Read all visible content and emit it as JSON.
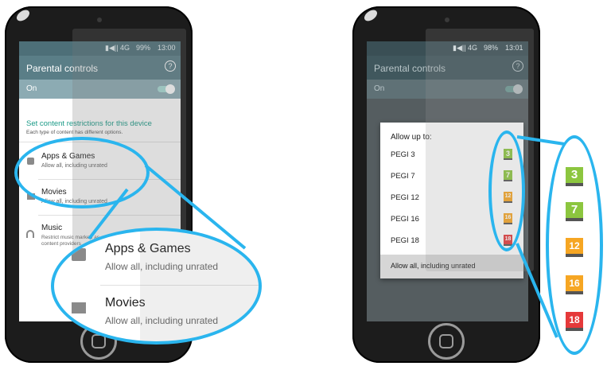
{
  "left_phone": {
    "status": {
      "signal": "▮◀|| 4G",
      "battery": "99%",
      "time": "13:00"
    },
    "appbar_title": "Parental controls",
    "help_glyph": "?",
    "on_label": "On",
    "section_title": "Set content restrictions for this device",
    "section_subtitle": "Each type of content has different options.",
    "items": [
      {
        "title": "Apps & Games",
        "subtitle": "Allow all, including unrated"
      },
      {
        "title": "Movies",
        "subtitle": "Allow all, including unrated"
      },
      {
        "title": "Music",
        "subtitle": "Restrict music marked as explicit by content providers"
      }
    ],
    "music_subtitle_line1": "Restrict music marked as",
    "music_subtitle_line2": "content providers",
    "zoom": [
      {
        "title": "Apps & Games",
        "subtitle": "Allow all, including unrated"
      },
      {
        "title": "Movies",
        "subtitle": "Allow all, including unrated"
      }
    ]
  },
  "right_phone": {
    "status": {
      "signal": "▮◀|| 4G",
      "battery": "98%",
      "time": "13:01"
    },
    "appbar_title": "Parental controls",
    "help_glyph": "?",
    "on_label": "On",
    "dialog_title": "Allow up to:",
    "options": [
      {
        "label": "PEGI 3",
        "badge": "3",
        "color": "#8cc63f"
      },
      {
        "label": "PEGI 7",
        "badge": "7",
        "color": "#8cc63f"
      },
      {
        "label": "PEGI 12",
        "badge": "12",
        "color": "#f6a623"
      },
      {
        "label": "PEGI 16",
        "badge": "16",
        "color": "#f6a623"
      },
      {
        "label": "PEGI 18",
        "badge": "18",
        "color": "#e5393a"
      }
    ],
    "selected_option": "Allow all, including unrated"
  },
  "colors": {
    "accent_teal": "#1a9a87",
    "appbar": "#5a7e87",
    "callout": "#2ab5ee",
    "phone_body": "#1c1c1c"
  }
}
